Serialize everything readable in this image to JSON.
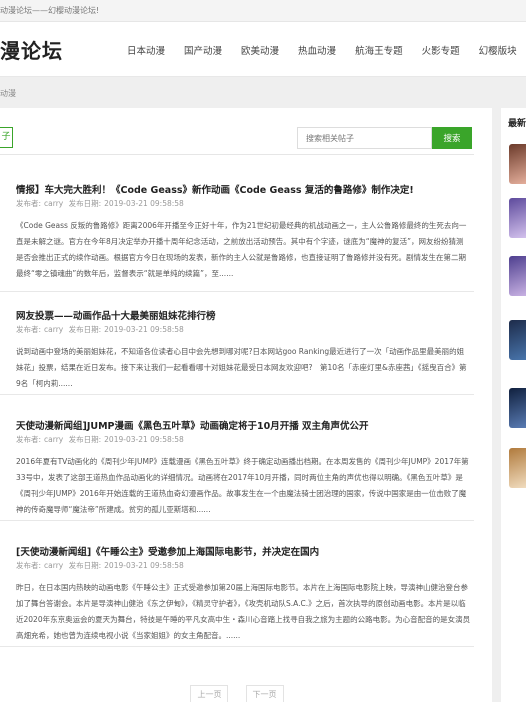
{
  "topbar": {
    "welcome": "动漫论坛——幻樱动漫论坛!"
  },
  "header": {
    "logo": "漫论坛",
    "nav": [
      "日本动漫",
      "国产动漫",
      "欧美动漫",
      "热血动漫",
      "航海王专题",
      "火影专题",
      "幻樱版块"
    ]
  },
  "breadcrumb": "动漫",
  "toolbar": {
    "tab_label": "子",
    "search_placeholder": "搜索相关帖子",
    "search_button": "搜索"
  },
  "posts": [
    {
      "title": "情报】车大完大胜利！《Code Geass》新作动画《Code Geass 复活的鲁路修》制作决定!",
      "author_label": "发布者:",
      "author": "carry",
      "time_label": "发布日期:",
      "time": "2019-03-21 09:58:58",
      "excerpt": "《Code Geass 反叛的鲁路修》距离2006年开播至今正好十年，作为21世纪初最经典的机战动画之一，主人公鲁路修最终的生死去向一直是未解之谜。官方在今年8月决定举办开播十周年纪念活动，之前放出活动预告。其中有个字迹，谜底为“魔神的复活”，网友纷纷猜测是否会推出正式的续作动画。根据官方今日在现场的发表，新作的主人公就是鲁路修，也直接证明了鲁路修并没有死。剧情发生在第二期最终“零之镇魂曲”的数年后，监督表示“就是单纯的续篇”，至......"
    },
    {
      "title": "网友投票——动画作品十大最美丽姐妹花排行榜",
      "author_label": "发布者:",
      "author": "carry",
      "time_label": "发布日期:",
      "time": "2019-03-21 09:58:58",
      "excerpt": "说到动画中登场的美丽姐妹花，不知道各位读者心目中会先想到哪对呢?日本网站goo Ranking最近进行了一次「动画作品里最美丽的姐妹花」投票，结果在近日发布。接下来让我们一起看看哪十对姐妹花最受日本网友欢迎吧?　第10名「赤座灯里&赤座茜」《摇曳百合》第9名「柯内莉......"
    },
    {
      "title": "天使动漫新闻组]JUMP漫画《黑色五叶草》动画确定将于10月开播 双主角声优公开",
      "author_label": "发布者:",
      "author": "carry",
      "time_label": "发布日期:",
      "time": "2019-03-21 09:58:58",
      "excerpt": "2016年夏有TV动画化的《周刊少年JUMP》连载漫画《黑色五叶草》终于确定动画播出档期。在本周发售的《周刊少年JUMP》2017年第33号中，发表了这部王道热血作品动画化的详细情况。动画将在2017年10月开播，同时两位主角的声优也得以明确。《黑色五叶草》是《周刊少年JUMP》2016年开始连载的王道热血奇幻漫画作品。故事发生在一个由魔法骑士团治理的国家，传说中国家是由一位击败了魔神的传奇魔导师“魔法帝”所建成。贫穷的孤儿亚斯塔和......"
    },
    {
      "title": "[天使动漫新闻组]《午睡公主》受邀参加上海国际电影节，并决定在国内",
      "author_label": "发布者:",
      "author": "carry",
      "time_label": "发布日期:",
      "time": "2019-03-21 09:58:58",
      "excerpt": "昨日，在日本国内热映的动画电影《午睡公主》正式受邀参加第20届上海国际电影节。本片在上海国际电影院上映，导演神山健治登台参加了舞台答谢会。本片是导演神山健治《东之伊甸》，《精灵守护者》，《攻壳机动队S.A.C.》之后，首次执导的原创动画电影。本片是以临近2020年东京奥运会的夏天为舞台，特技是午睡的平凡女高中生・森川心音踏上找寻自我之旅为主题的公路电影。为心音配音的是女演员高畑充希，她也曾为连续电视小说《当家姐姐》的女主角配音。......"
    }
  ],
  "pager": {
    "prev": "上一页",
    "next": "下一页"
  },
  "sidebar": {
    "heading": "最新",
    "thumbnails": [
      {
        "icon": "anime-avatar",
        "colors": [
          "#6b3a2a",
          "#e9b3a0"
        ]
      },
      {
        "icon": "anime-avatar",
        "colors": [
          "#5d4a9c",
          "#d8c6f0"
        ]
      },
      {
        "icon": "anime-avatar",
        "colors": [
          "#4e3f8f",
          "#cdb6e6"
        ]
      },
      {
        "icon": "night-scene",
        "colors": [
          "#1d2b4a",
          "#4a78b0"
        ]
      },
      {
        "icon": "night-scene",
        "colors": [
          "#10203e",
          "#5c7fb8"
        ]
      },
      {
        "icon": "dog-photo",
        "colors": [
          "#b07a3c",
          "#f3e0c4"
        ]
      }
    ]
  }
}
